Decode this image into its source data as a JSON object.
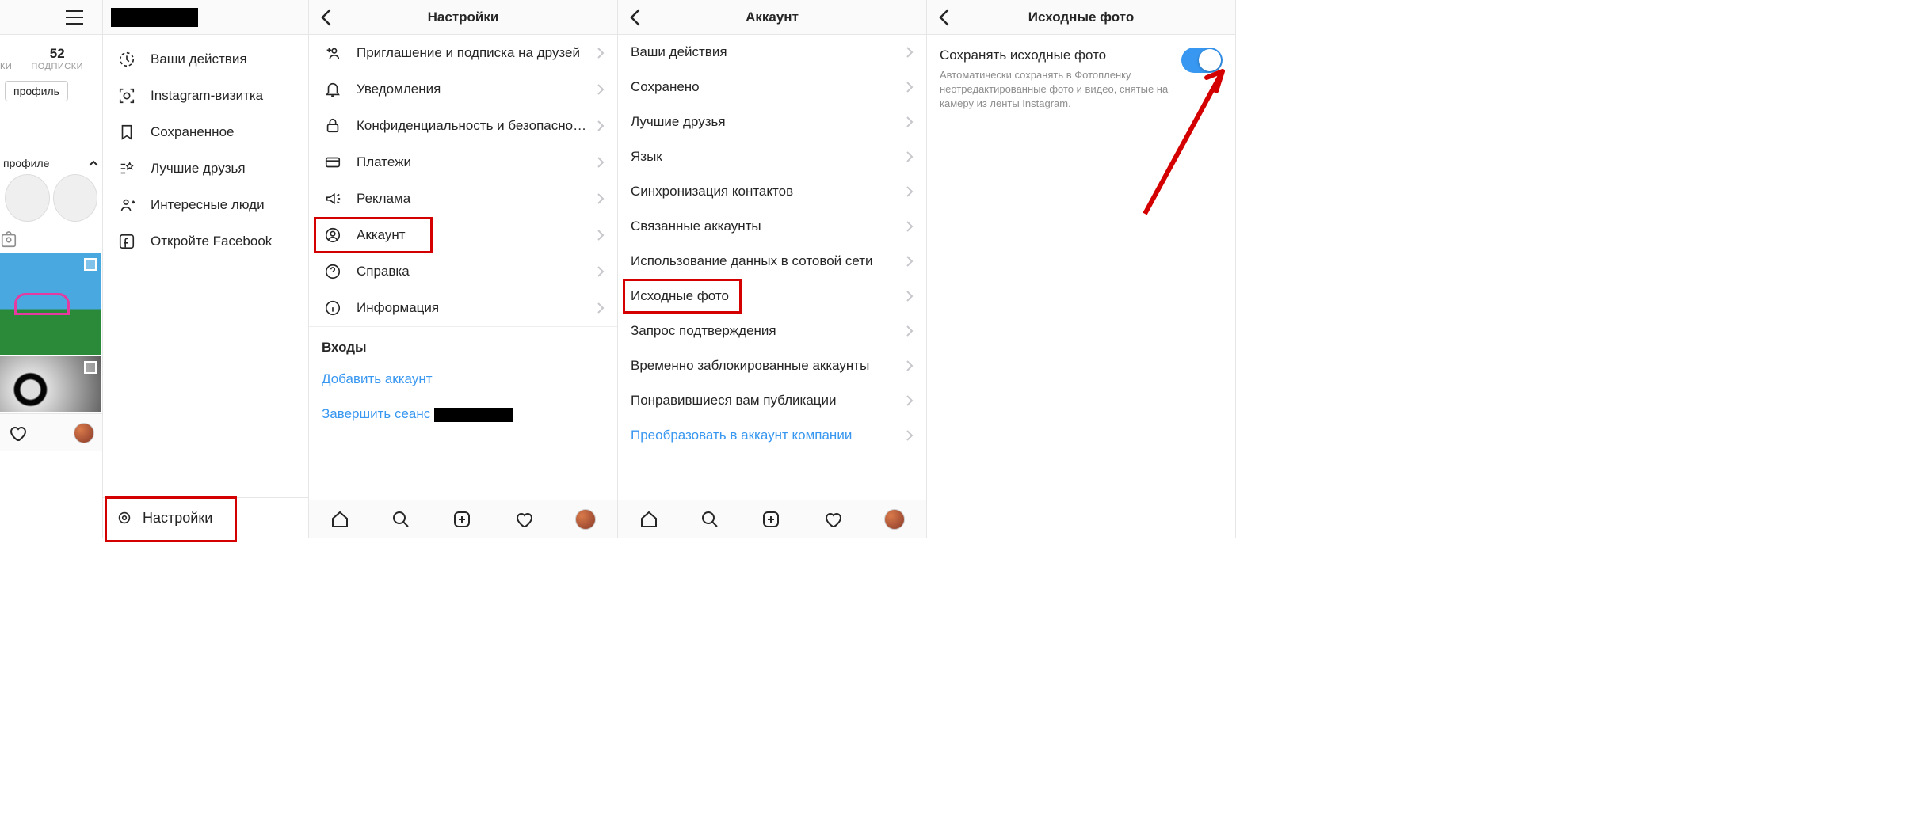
{
  "col1": {
    "stats": {
      "num": "52",
      "label": "подписки"
    },
    "stats_cut_label": "ки",
    "edit_profile_btn": "профиль",
    "profile_hint": "профиле",
    "menu": [
      {
        "icon": "activity",
        "label": "Ваши действия"
      },
      {
        "icon": "nametag",
        "label": "Instagram-визитка"
      },
      {
        "icon": "bookmark",
        "label": "Сохраненное"
      },
      {
        "icon": "closefriends",
        "label": "Лучшие друзья"
      },
      {
        "icon": "discover",
        "label": "Интересные люди"
      },
      {
        "icon": "facebook",
        "label": "Откройте Facebook"
      }
    ],
    "settings_label": "Настройки"
  },
  "col2": {
    "title": "Настройки",
    "items": [
      {
        "icon": "invite",
        "label": "Приглашение и подписка на друзей"
      },
      {
        "icon": "bell",
        "label": "Уведомления"
      },
      {
        "icon": "lock",
        "label": "Конфиденциальность и безопасно…"
      },
      {
        "icon": "card",
        "label": "Платежи"
      },
      {
        "icon": "ads",
        "label": "Реклама"
      },
      {
        "icon": "account",
        "label": "Аккаунт"
      },
      {
        "icon": "help",
        "label": "Справка"
      },
      {
        "icon": "info",
        "label": "Информация"
      }
    ],
    "logins_header": "Входы",
    "add_account": "Добавить аккаунт",
    "logout": "Завершить сеанс"
  },
  "col3": {
    "title": "Аккаунт",
    "items": [
      "Ваши действия",
      "Сохранено",
      "Лучшие друзья",
      "Язык",
      "Синхронизация контактов",
      "Связанные аккаунты",
      "Использование данных в сотовой сети",
      "Исходные фото",
      "Запрос подтверждения",
      "Временно заблокированные аккаунты",
      "Понравившиеся вам публикации",
      "Преобразовать в аккаунт компании"
    ]
  },
  "col4": {
    "title": "Исходные фото",
    "pref_title": "Сохранять исходные фото",
    "pref_desc": "Автоматически сохранять в Фотопленку неотредактированные фото и видео, снятые на камеру из ленты Instagram."
  }
}
